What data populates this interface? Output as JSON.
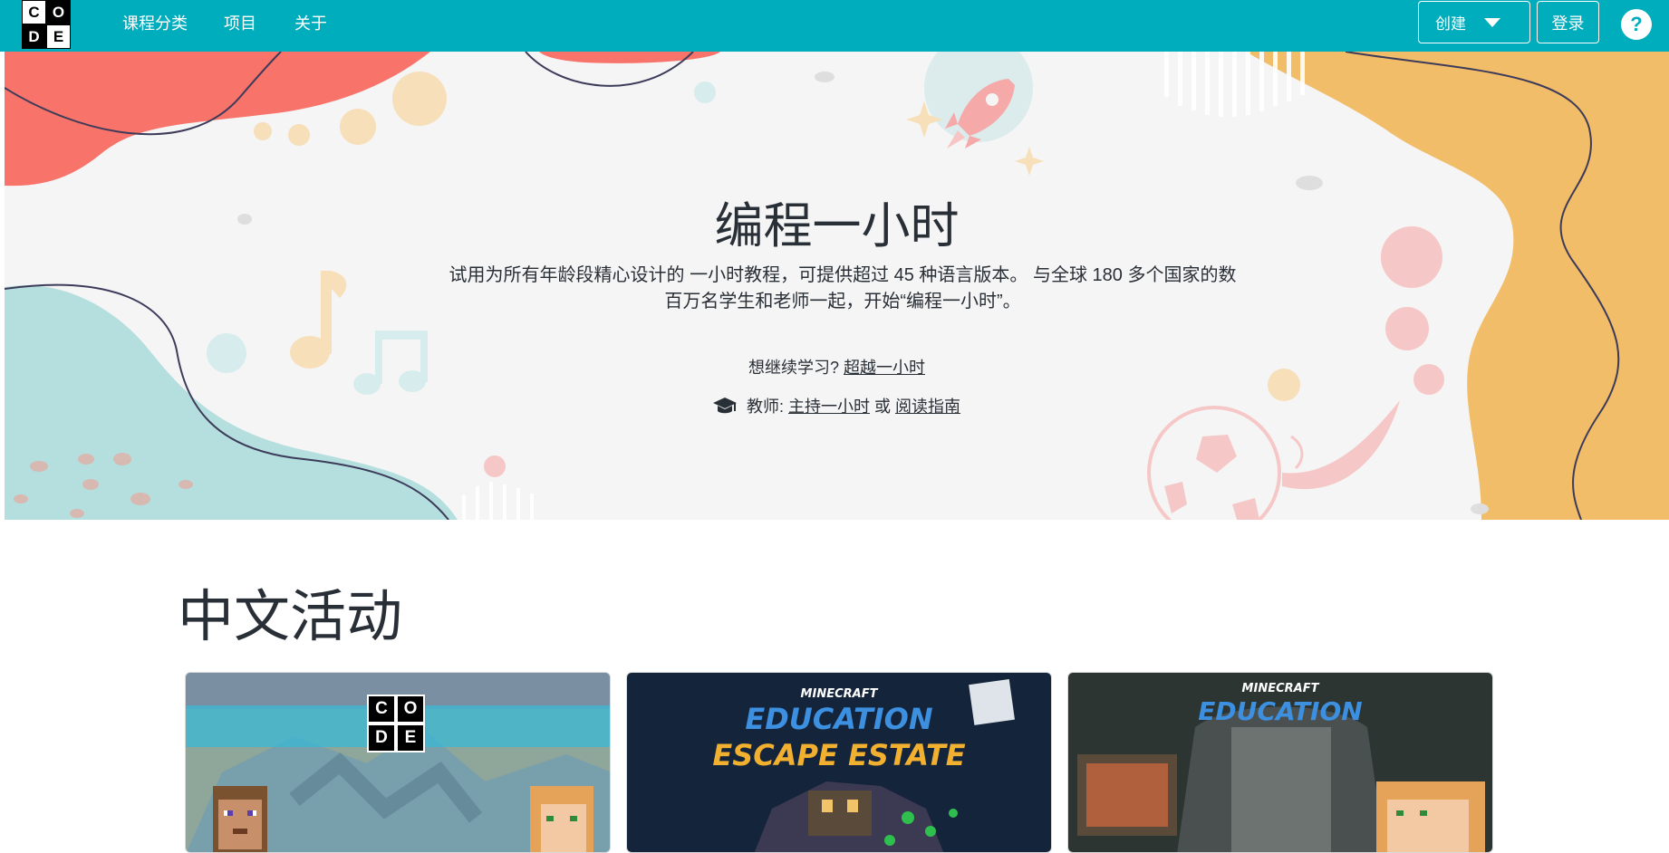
{
  "nav": {
    "logo_letters": [
      "C",
      "O",
      "D",
      "E"
    ],
    "links": [
      "课程分类",
      "项目",
      "关于"
    ],
    "create_label": "创建",
    "login_label": "登录",
    "help_label": "?"
  },
  "hero": {
    "title": "编程一小时",
    "subtitle": "试用为所有年龄段精心设计的 一小时教程，可提供超过 45 种语言版本。 与全球 180 多个国家的数百万名学生和老师一起，开始“编程一小时”。",
    "continue_prefix": "想继续学习?",
    "continue_link": "超越一小时",
    "teacher_prefix": "教师:",
    "host_link": "主持一小时",
    "or_text": "或",
    "guide_link": "阅读指南",
    "icons": [
      "graduation-cap-icon",
      "music-note-icon",
      "rocket-icon",
      "soccer-ball-icon"
    ]
  },
  "section": {
    "title": "中文活动",
    "cards": [
      {
        "name": "minecraft-code-card",
        "logo_letters": [
          "C",
          "O",
          "D",
          "E"
        ]
      },
      {
        "name": "escape-estate-card",
        "brand": "MINECRAFT",
        "line1": "EDUCATION",
        "line2": "ESCAPE ESTATE"
      },
      {
        "name": "minecraft-education-card",
        "brand": "MINECRAFT",
        "line1": "EDUCATION"
      }
    ]
  },
  "colors": {
    "nav_bg": "#00adbc",
    "hero_bg": "#f5f5f5",
    "coral": "#f8736a",
    "mustard": "#f2bd68",
    "teal": "#b4dfde",
    "text": "#292f36"
  }
}
